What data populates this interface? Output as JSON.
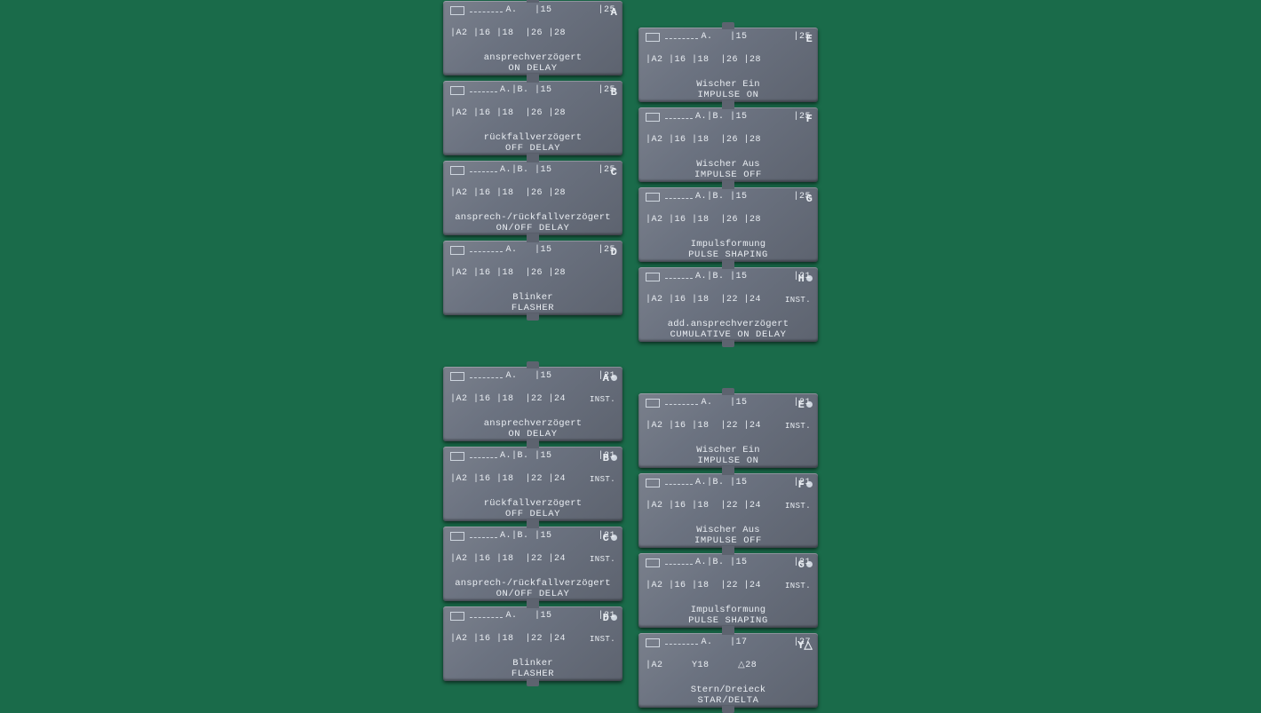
{
  "plates": [
    {
      "id": "A",
      "tag": "A",
      "de": "ansprechverzögert",
      "en": "ON DELAY",
      "top": "A.   |15        |25",
      "bot": "|A2 |16 |18  |26 |28",
      "inst": ""
    },
    {
      "id": "B",
      "tag": "B",
      "de": "rückfallverzögert",
      "en": "OFF DELAY",
      "top": "A.|B. |15        |25",
      "bot": "|A2 |16 |18  |26 |28",
      "inst": ""
    },
    {
      "id": "C",
      "tag": "C",
      "de": "ansprech-/rückfallverzögert",
      "en": "ON/OFF DELAY",
      "top": "A.|B. |15        |25",
      "bot": "|A2 |16 |18  |26 |28",
      "inst": ""
    },
    {
      "id": "D",
      "tag": "D",
      "de": "Blinker",
      "en": "FLASHER",
      "top": "A.   |15        |25",
      "bot": "|A2 |16 |18  |26 |28",
      "inst": ""
    },
    {
      "id": "E",
      "tag": "E",
      "de": "Wischer Ein",
      "en": "IMPULSE ON",
      "top": "A.   |15        |25",
      "bot": "|A2 |16 |18  |26 |28",
      "inst": ""
    },
    {
      "id": "F",
      "tag": "F",
      "de": "Wischer Aus",
      "en": "IMPULSE OFF",
      "top": "A.|B. |15        |25",
      "bot": "|A2 |16 |18  |26 |28",
      "inst": ""
    },
    {
      "id": "G",
      "tag": "G",
      "de": "Impulsformung",
      "en": "PULSE SHAPING",
      "top": "A.|B. |15        |25",
      "bot": "|A2 |16 |18  |26 |28",
      "inst": ""
    },
    {
      "id": "H",
      "tag": "H●",
      "de": "add.ansprechverzögert",
      "en": "CUMULATIVE ON DELAY",
      "top": "A.|B. |15        |21",
      "bot": "|A2 |16 |18  |22 |24",
      "inst": "INST."
    },
    {
      "id": "A2",
      "tag": "A●",
      "de": "ansprechverzögert",
      "en": "ON DELAY",
      "top": "A.   |15        |21",
      "bot": "|A2 |16 |18  |22 |24",
      "inst": "INST."
    },
    {
      "id": "B2",
      "tag": "B●",
      "de": "rückfallverzögert",
      "en": "OFF DELAY",
      "top": "A.|B. |15        |21",
      "bot": "|A2 |16 |18  |22 |24",
      "inst": "INST."
    },
    {
      "id": "C2",
      "tag": "C●",
      "de": "ansprech-/rückfallverzögert",
      "en": "ON/OFF DELAY",
      "top": "A.|B. |15        |21",
      "bot": "|A2 |16 |18  |22 |24",
      "inst": "INST."
    },
    {
      "id": "D2",
      "tag": "D●",
      "de": "Blinker",
      "en": "FLASHER",
      "top": "A.   |15        |21",
      "bot": "|A2 |16 |18  |22 |24",
      "inst": "INST."
    },
    {
      "id": "E2",
      "tag": "E●",
      "de": "Wischer Ein",
      "en": "IMPULSE ON",
      "top": "A.   |15        |21",
      "bot": "|A2 |16 |18  |22 |24",
      "inst": "INST."
    },
    {
      "id": "F2",
      "tag": "F●",
      "de": "Wischer Aus",
      "en": "IMPULSE OFF",
      "top": "A.|B. |15        |21",
      "bot": "|A2 |16 |18  |22 |24",
      "inst": "INST."
    },
    {
      "id": "G2",
      "tag": "G●",
      "de": "Impulsformung",
      "en": "PULSE SHAPING",
      "top": "A.|B. |15        |21",
      "bot": "|A2 |16 |18  |22 |24",
      "inst": "INST."
    },
    {
      "id": "YD",
      "tag": "Y△",
      "de": "Stern/Dreieck",
      "en": "STAR/DELTA",
      "top": "A.   |17        |27",
      "bot": "|A2     Y18     △28",
      "inst": ""
    }
  ],
  "groups": [
    {
      "left": [
        "A",
        "B",
        "C",
        "D"
      ],
      "right": [
        "E",
        "F",
        "G",
        "H"
      ]
    },
    {
      "left": [
        "A2",
        "B2",
        "C2",
        "D2"
      ],
      "right": [
        "E2",
        "F2",
        "G2",
        "YD"
      ]
    }
  ]
}
